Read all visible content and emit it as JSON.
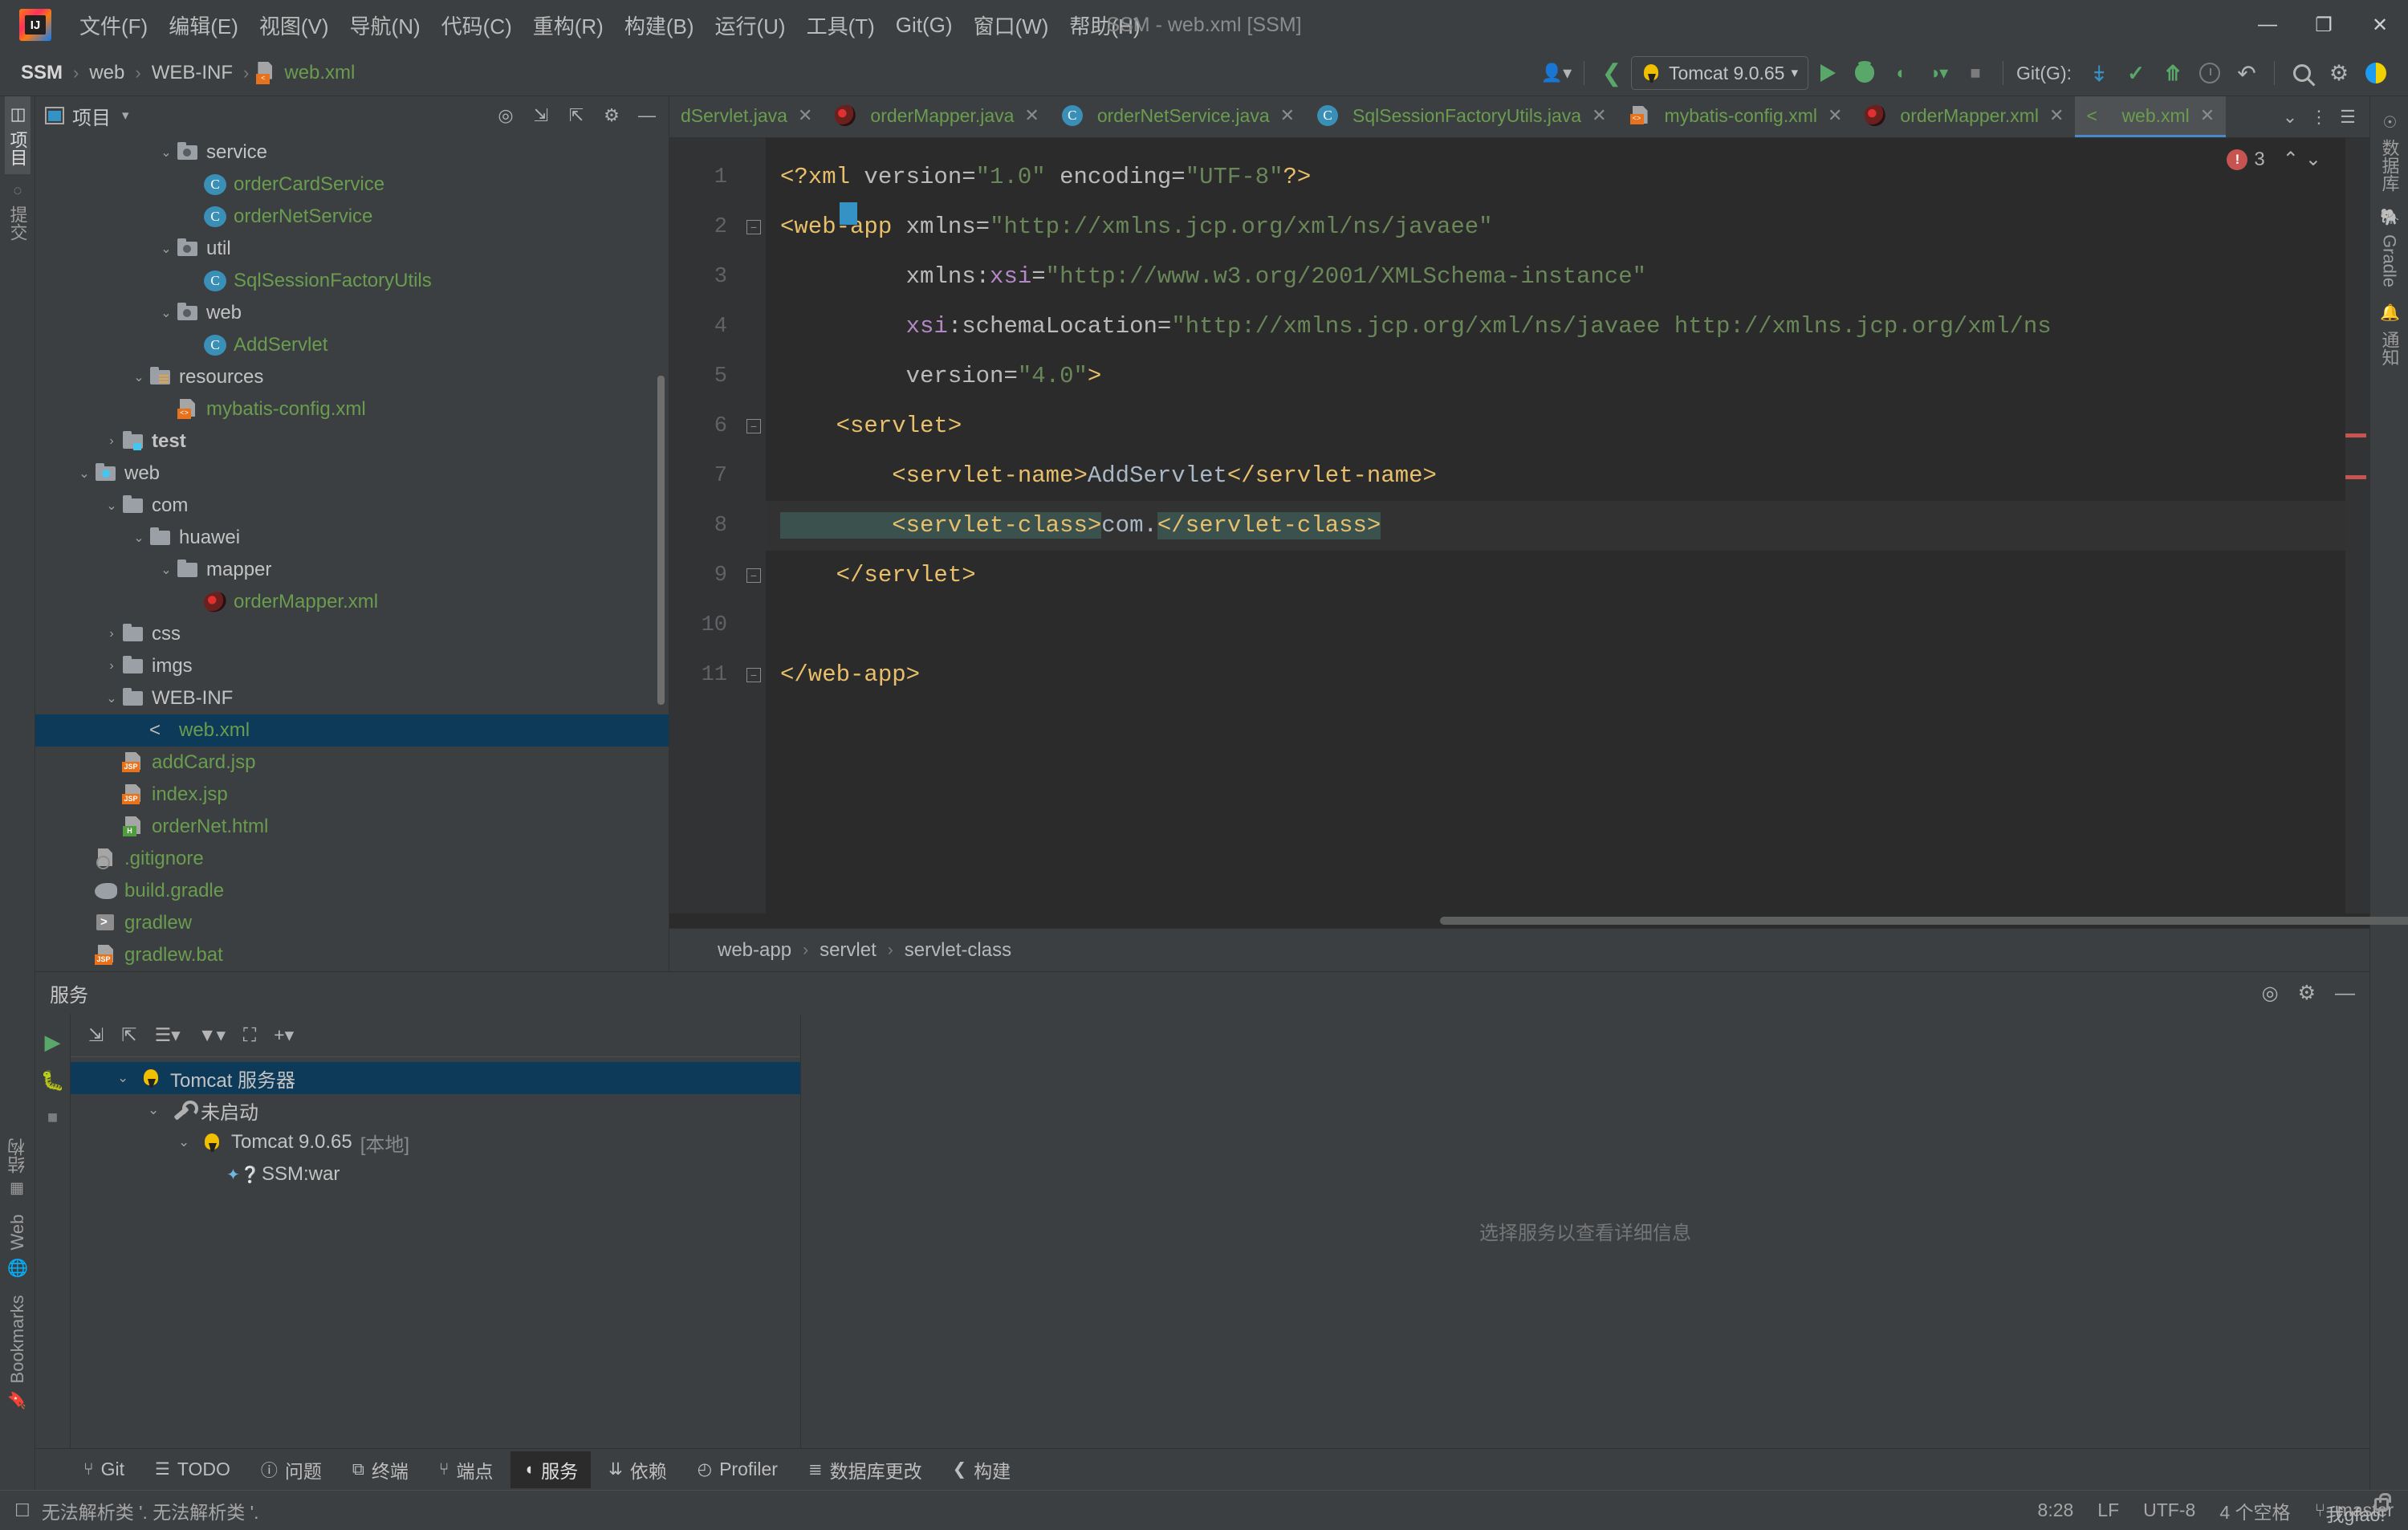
{
  "window": {
    "title": "SSM - web.xml [SSM]",
    "menus": [
      "文件(F)",
      "编辑(E)",
      "视图(V)",
      "导航(N)",
      "代码(C)",
      "重构(R)",
      "构建(B)",
      "运行(U)",
      "工具(T)",
      "Git(G)",
      "窗口(W)",
      "帮助(H)"
    ],
    "controls": {
      "minimize": "—",
      "maximize": "❐",
      "close": "✕"
    }
  },
  "navbar": {
    "crumbs": [
      "SSM",
      "web",
      "WEB-INF",
      "web.xml"
    ],
    "separator": "›",
    "run_config": "Tomcat 9.0.65",
    "git_label": "Git(G):"
  },
  "project": {
    "title": "项目",
    "tree": [
      {
        "indent": 4,
        "twisty": "⌄",
        "icon": "pkg",
        "label": "service",
        "style": "grey"
      },
      {
        "indent": 5,
        "twisty": "",
        "icon": "cls",
        "label": "orderCardService",
        "style": "green"
      },
      {
        "indent": 5,
        "twisty": "",
        "icon": "cls",
        "label": "orderNetService",
        "style": "green"
      },
      {
        "indent": 4,
        "twisty": "⌄",
        "icon": "pkg",
        "label": "util",
        "style": "grey"
      },
      {
        "indent": 5,
        "twisty": "",
        "icon": "cls",
        "label": "SqlSessionFactoryUtils",
        "style": "green"
      },
      {
        "indent": 4,
        "twisty": "⌄",
        "icon": "pkg",
        "label": "web",
        "style": "grey"
      },
      {
        "indent": 5,
        "twisty": "",
        "icon": "cls",
        "label": "AddServlet",
        "style": "green"
      },
      {
        "indent": 3,
        "twisty": "⌄",
        "icon": "res",
        "label": "resources",
        "style": "grey"
      },
      {
        "indent": 4,
        "twisty": "",
        "icon": "xml",
        "label": "mybatis-config.xml",
        "style": "green"
      },
      {
        "indent": 2,
        "twisty": "›",
        "icon": "test",
        "label": "test",
        "style": "greybold"
      },
      {
        "indent": 1,
        "twisty": "⌄",
        "icon": "webroot",
        "label": "web",
        "style": "grey"
      },
      {
        "indent": 2,
        "twisty": "⌄",
        "icon": "folder",
        "label": "com",
        "style": "grey"
      },
      {
        "indent": 3,
        "twisty": "⌄",
        "icon": "folder",
        "label": "huawei",
        "style": "grey"
      },
      {
        "indent": 4,
        "twisty": "⌄",
        "icon": "folder",
        "label": "mapper",
        "style": "grey"
      },
      {
        "indent": 5,
        "twisty": "",
        "icon": "mybatis",
        "label": "orderMapper.xml",
        "style": "green"
      },
      {
        "indent": 2,
        "twisty": "›",
        "icon": "folder",
        "label": "css",
        "style": "grey"
      },
      {
        "indent": 2,
        "twisty": "›",
        "icon": "folder",
        "label": "imgs",
        "style": "grey"
      },
      {
        "indent": 2,
        "twisty": "⌄",
        "icon": "folder",
        "label": "WEB-INF",
        "style": "grey"
      },
      {
        "indent": 3,
        "twisty": "",
        "icon": "xmlweb",
        "label": "web.xml",
        "style": "green",
        "selected": true
      },
      {
        "indent": 2,
        "twisty": "",
        "icon": "jsp",
        "label": "addCard.jsp",
        "style": "green"
      },
      {
        "indent": 2,
        "twisty": "",
        "icon": "jsp",
        "label": "index.jsp",
        "style": "green"
      },
      {
        "indent": 2,
        "twisty": "",
        "icon": "html",
        "label": "orderNet.html",
        "style": "green"
      },
      {
        "indent": 1,
        "twisty": "",
        "icon": "gitign",
        "label": ".gitignore",
        "style": "green"
      },
      {
        "indent": 1,
        "twisty": "",
        "icon": "gradle",
        "label": "build.gradle",
        "style": "green"
      },
      {
        "indent": 1,
        "twisty": "",
        "icon": "sh",
        "label": "gradlew",
        "style": "green"
      },
      {
        "indent": 1,
        "twisty": "",
        "icon": "jsp",
        "label": "gradlew.bat",
        "style": "green"
      }
    ]
  },
  "editor": {
    "tabs": [
      {
        "label": "dServlet.java",
        "icon": "cls",
        "clipped": true
      },
      {
        "label": "orderMapper.java",
        "icon": "mybatis"
      },
      {
        "label": "orderNetService.java",
        "icon": "cls"
      },
      {
        "label": "SqlSessionFactoryUtils.java",
        "icon": "cls"
      },
      {
        "label": "mybatis-config.xml",
        "icon": "xml"
      },
      {
        "label": "orderMapper.xml",
        "icon": "mybatis"
      },
      {
        "label": "web.xml",
        "icon": "xmlweb",
        "active": true
      }
    ],
    "close_glyph": "✕",
    "tab_overflow": "⌄",
    "tab_more": "⋮",
    "error_count": "3",
    "error_up": "⌃",
    "error_down": "⌄",
    "line_numbers": [
      "1",
      "2",
      "3",
      "4",
      "5",
      "6",
      "7",
      "8",
      "9",
      "10",
      "11"
    ],
    "code_lines": [
      "<?xml version=\"1.0\" encoding=\"UTF-8\"?>",
      "<web-app xmlns=\"http://xmlns.jcp.org/xml/ns/javaee\"",
      "         xmlns:xsi=\"http://www.w3.org/2001/XMLSchema-instance\"",
      "         xsi:schemaLocation=\"http://xmlns.jcp.org/xml/ns/javaee http://xmlns.jcp.org/xml/ns",
      "         version=\"4.0\">",
      "    <servlet>",
      "        <servlet-name>AddServlet</servlet-name>",
      "        <servlet-class>com.</servlet-class>",
      "    </servlet>",
      "",
      "</web-app>"
    ],
    "breadcrumb": [
      "web-app",
      "servlet",
      "servlet-class"
    ],
    "breadcrumb_sep": "›"
  },
  "services": {
    "title": "服务",
    "tree": [
      {
        "indent": 1,
        "twisty": "⌄",
        "icon": "tomcat",
        "label": "Tomcat 服务器",
        "selected": true
      },
      {
        "indent": 2,
        "twisty": "⌄",
        "icon": "wrench",
        "label": "未启动"
      },
      {
        "indent": 3,
        "twisty": "⌄",
        "icon": "tomcat-o",
        "label": "Tomcat 9.0.65",
        "suffix": "[本地]"
      },
      {
        "indent": 4,
        "twisty": "",
        "icon": "war",
        "label": "SSM:war"
      }
    ],
    "detail_placeholder": "选择服务以查看详细信息"
  },
  "status_tabs": [
    {
      "label": "Git",
      "icon": "git-branch-icon"
    },
    {
      "label": "TODO",
      "icon": "list-icon"
    },
    {
      "label": "问题",
      "icon": "warning-icon"
    },
    {
      "label": "终端",
      "icon": "terminal-icon"
    },
    {
      "label": "端点",
      "icon": "endpoints-icon"
    },
    {
      "label": "服务",
      "icon": "services-icon",
      "active": true
    },
    {
      "label": "依赖",
      "icon": "dependencies-icon"
    },
    {
      "label": "Profiler",
      "icon": "profiler-icon"
    },
    {
      "label": "数据库更改",
      "icon": "db-changes-icon"
    },
    {
      "label": "构建",
      "icon": "build-icon"
    }
  ],
  "statusbar": {
    "message": "无法解析类 '. 无法解析类 '.",
    "caret": "8:28",
    "line_sep": "LF",
    "encoding": "UTF-8",
    "indent": "4 个空格",
    "branch": "master",
    "branch_overlay": "我gfao!"
  },
  "left_stripe": [
    {
      "label": "项目",
      "icon": "project-icon",
      "active": true
    },
    {
      "label": "提交",
      "icon": "commit-icon"
    }
  ],
  "left_stripe_bottom": [
    {
      "label": "Bookmarks",
      "icon": "bookmark-icon"
    },
    {
      "label": "Web",
      "icon": "globe-icon"
    },
    {
      "label": "结构",
      "icon": "structure-icon"
    }
  ],
  "right_stripe": [
    {
      "label": "数据库",
      "icon": "database-icon"
    },
    {
      "label": "Gradle",
      "icon": "elephant-icon"
    },
    {
      "label": "通知",
      "icon": "bell-icon"
    }
  ],
  "colors": {
    "accent": "#4a88c7",
    "selection": "#0d3a58",
    "editor_bg": "#2b2b2b",
    "panel_bg": "#3c3f41",
    "tag": "#e8bf6a",
    "value": "#6a8759",
    "error": "#c75450",
    "green_file": "#6a9c4f"
  }
}
